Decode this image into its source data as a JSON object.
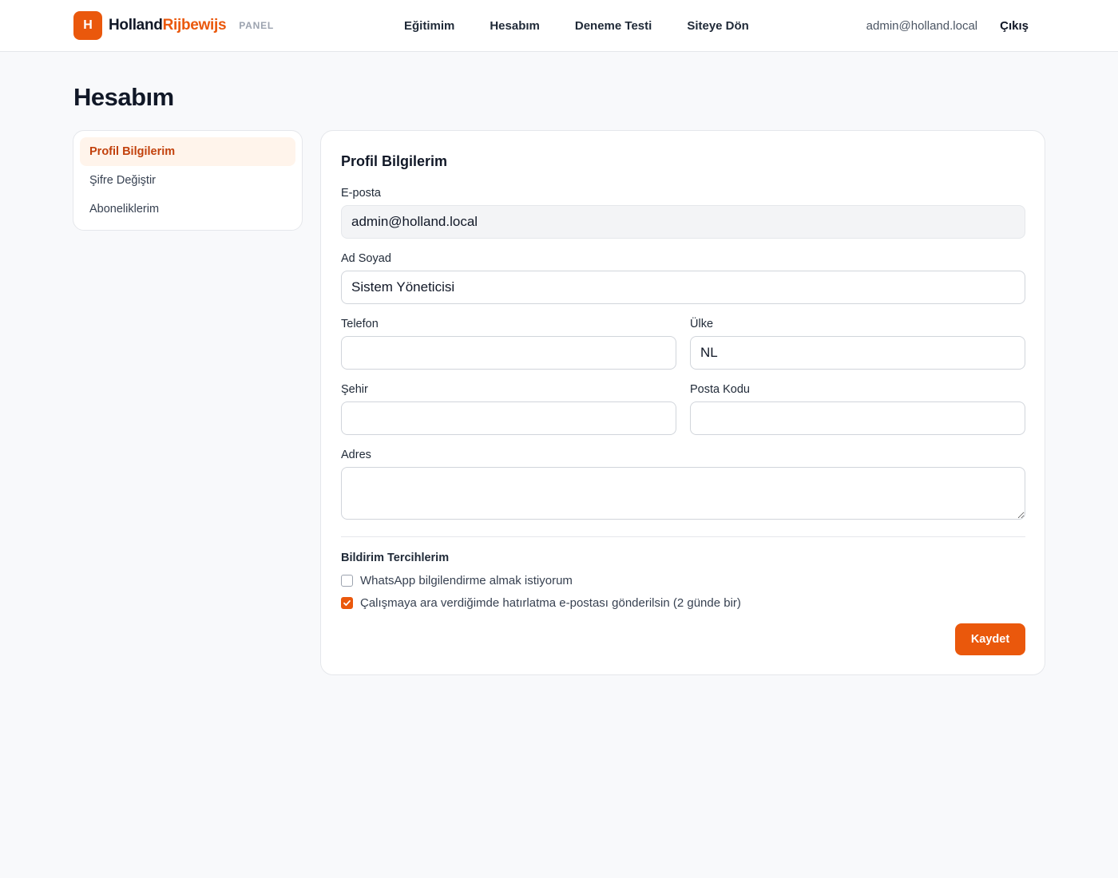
{
  "header": {
    "logo_letter": "H",
    "brand_part1": "Holland",
    "brand_part2": "Rijbewijs",
    "panel_tag": "PANEL",
    "nav": [
      "Eğitimim",
      "Hesabım",
      "Deneme Testi",
      "Siteye Dön"
    ],
    "user_email": "admin@holland.local",
    "logout_label": "Çıkış"
  },
  "page": {
    "title": "Hesabım"
  },
  "sidebar": {
    "items": [
      {
        "label": "Profil Bilgilerim",
        "active": true
      },
      {
        "label": "Şifre Değiştir",
        "active": false
      },
      {
        "label": "Aboneliklerim",
        "active": false
      }
    ]
  },
  "form": {
    "title": "Profil Bilgilerim",
    "email": {
      "label": "E-posta",
      "value": "admin@holland.local"
    },
    "fullname": {
      "label": "Ad Soyad",
      "value": "Sistem Yöneticisi"
    },
    "phone": {
      "label": "Telefon",
      "value": ""
    },
    "country": {
      "label": "Ülke",
      "value": "NL"
    },
    "city": {
      "label": "Şehir",
      "value": ""
    },
    "postal": {
      "label": "Posta Kodu",
      "value": ""
    },
    "address": {
      "label": "Adres",
      "value": ""
    },
    "notifications": {
      "title": "Bildirim Tercihlerim",
      "whatsapp": {
        "label": "WhatsApp bilgilendirme almak istiyorum",
        "checked": false
      },
      "reminder": {
        "label": "Çalışmaya ara verdiğimde hatırlatma e-postası gönderilsin (2 günde bir)",
        "checked": true
      }
    },
    "save_label": "Kaydet"
  },
  "colors": {
    "accent": "#ea580c",
    "accent_soft": "#fff4eb",
    "background": "#f8f9fb"
  }
}
